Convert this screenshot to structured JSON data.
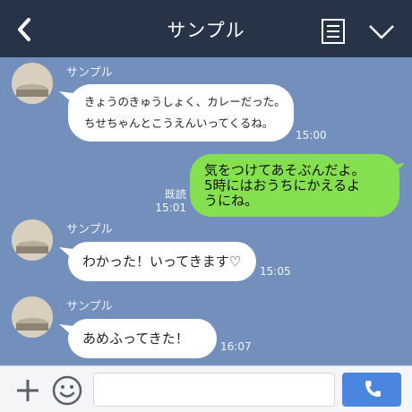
{
  "header": {
    "title": "サンプル",
    "icons": {
      "back": "back-chevron-icon",
      "menu": "menu-list-icon",
      "dropdown": "chevron-down-icon"
    }
  },
  "messages": [
    {
      "sender": "サンプル",
      "text": "きょうのきゅうしょく、カレーだった。\nちせちゃんとこうえんいってくるね。",
      "time": "15:00"
    },
    {
      "from_me": true,
      "text": "気をつけてあそぶんだよ。\n5時にはおうちにかえるよ\nうにね。",
      "read": "既読",
      "time": "15:01"
    },
    {
      "sender": "サンプル",
      "text": "わかった！いってきます♡",
      "time": "15:05"
    },
    {
      "sender": "サンプル",
      "text": "あめふってきた！",
      "time": "16:07"
    }
  ],
  "footer": {
    "input_placeholder": "",
    "icons": {
      "plus": "plus-icon",
      "emoji": "smiley-icon",
      "call": "phone-icon"
    }
  },
  "colors": {
    "header_bg": "#273346",
    "chat_bg": "#7390bd",
    "my_bubble": "#84e04f",
    "their_bubble": "#ffffff",
    "call_button": "#4a86e0"
  }
}
